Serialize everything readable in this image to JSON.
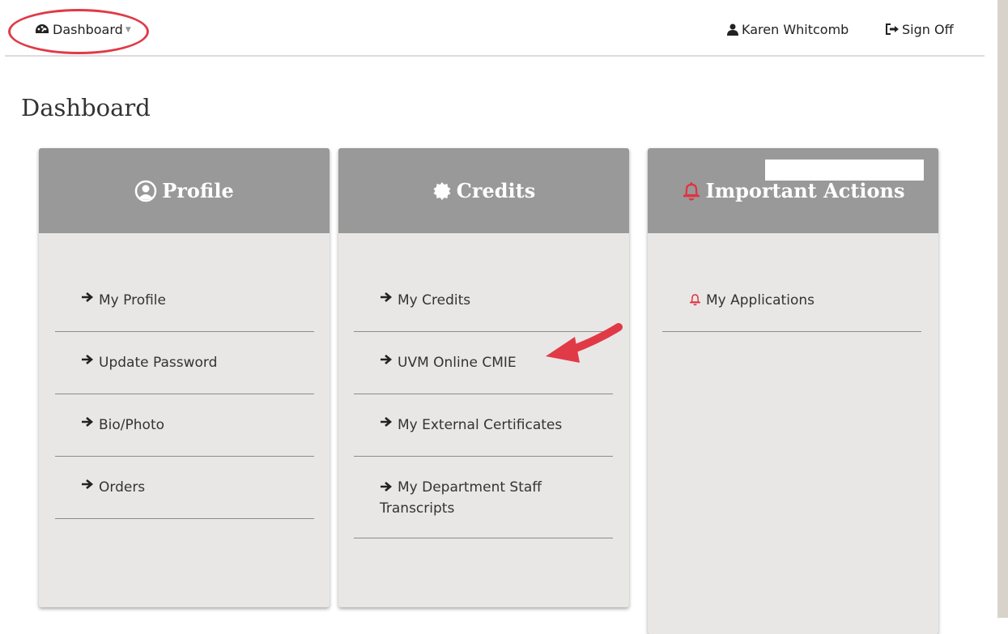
{
  "nav": {
    "dashboard_label": "Dashboard",
    "user_name": "Karen Whitcomb",
    "sign_off_label": "Sign Off"
  },
  "page": {
    "title": "Dashboard"
  },
  "cards": {
    "profile": {
      "title": "Profile",
      "items": [
        "My Profile",
        "Update Password",
        "Bio/Photo",
        "Orders"
      ]
    },
    "credits": {
      "title": "Credits",
      "items": [
        "My Credits",
        "UVM Online CMIE",
        "My External Certificates",
        "My Department Staff Transcripts"
      ]
    },
    "actions": {
      "title": "Important Actions",
      "items": [
        "My Applications"
      ]
    }
  },
  "colors": {
    "card_header": "#999999",
    "card_body": "#e9e7e6",
    "annotation_red": "#e03a47",
    "bell_red": "#e0333f"
  },
  "icons": [
    "dashboard-icon",
    "user-icon",
    "sign-off-icon",
    "profile-icon",
    "credits-badge-icon",
    "bell-icon",
    "arrow-right-icon"
  ]
}
